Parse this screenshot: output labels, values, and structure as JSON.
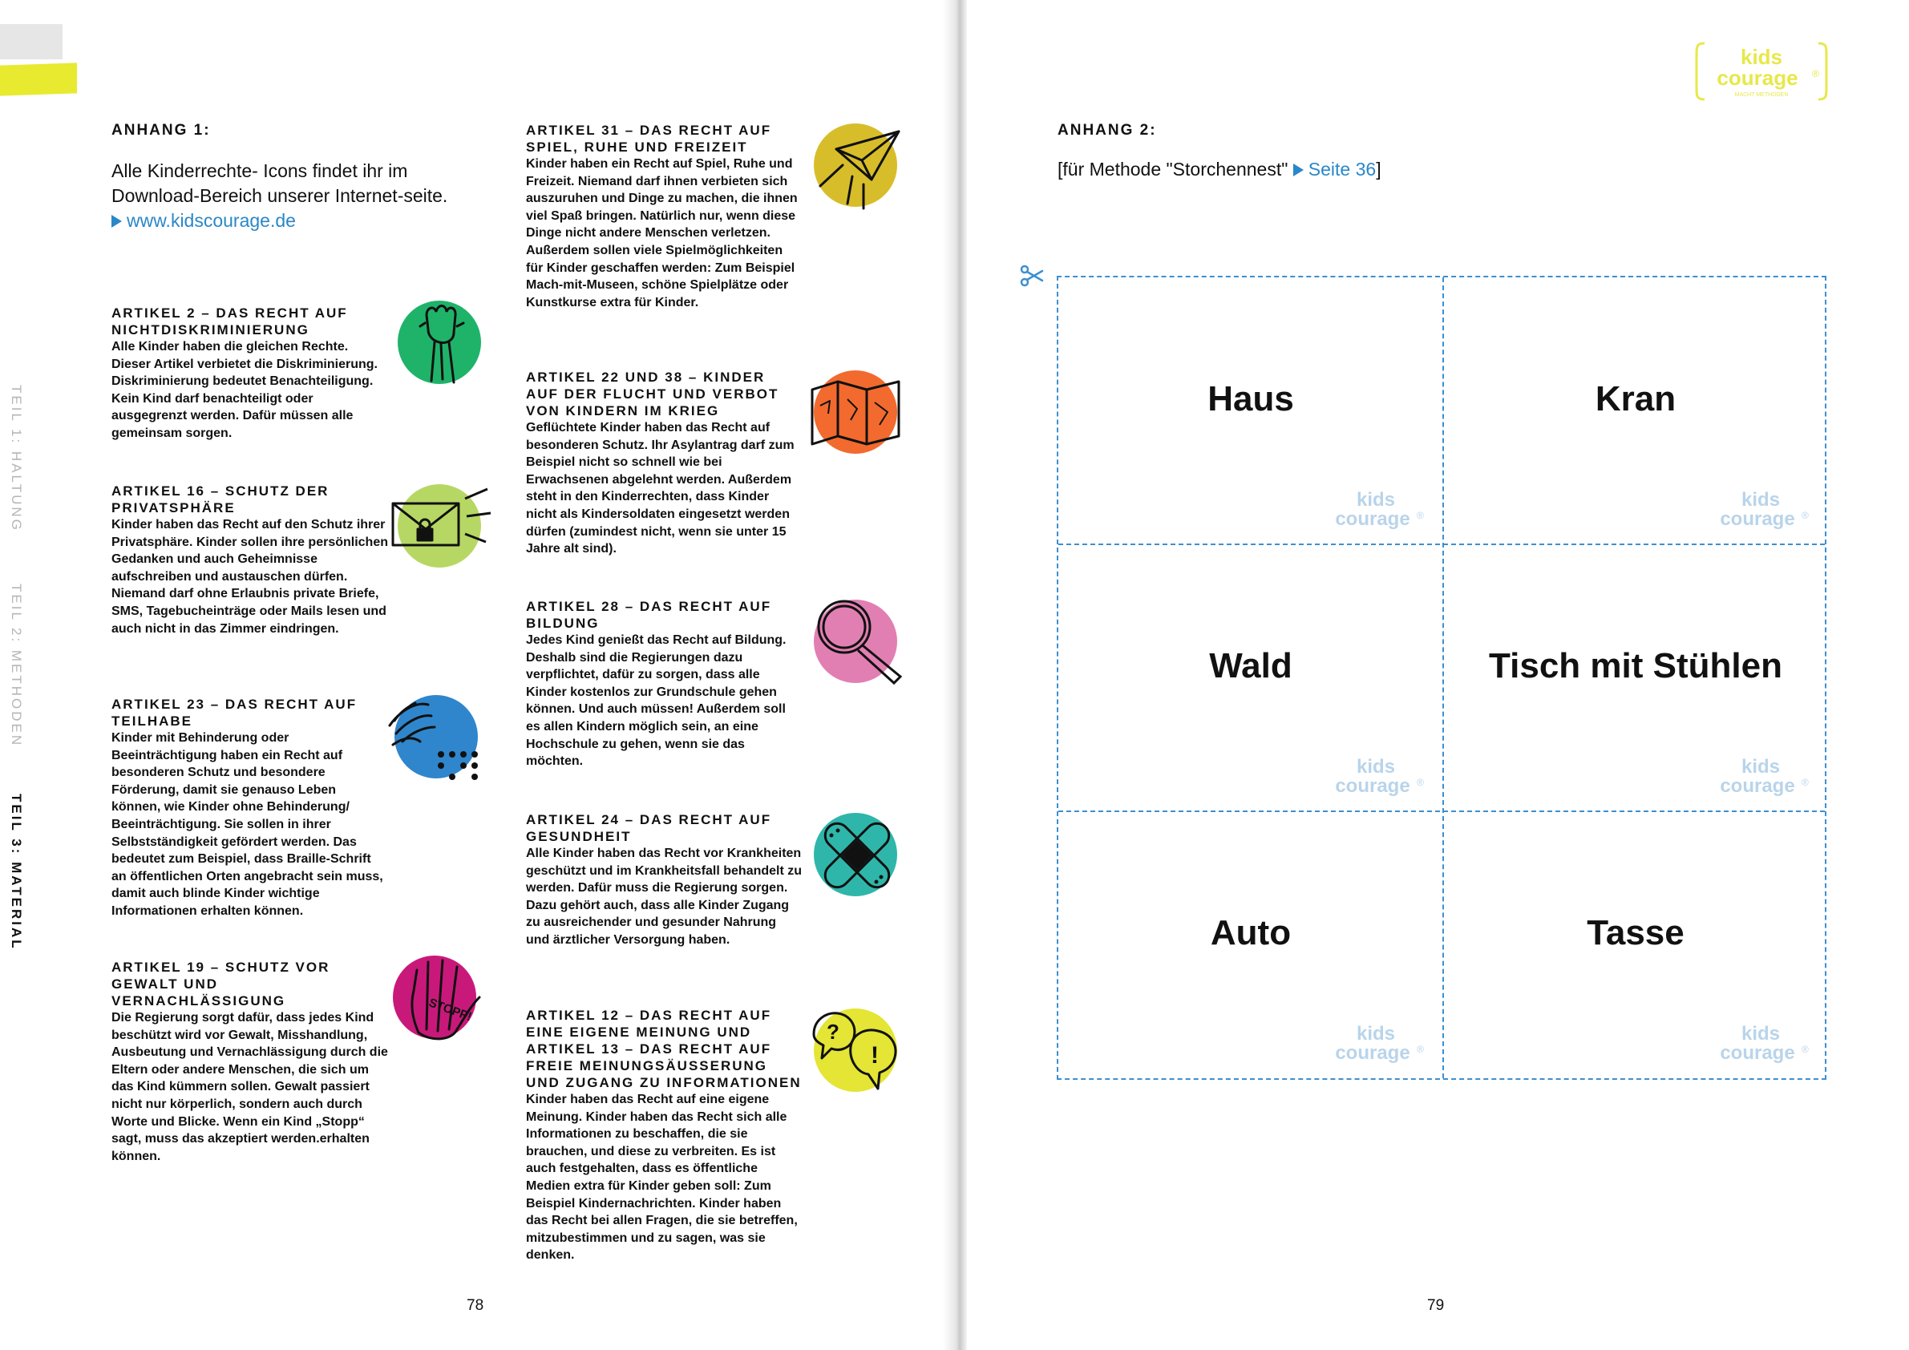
{
  "left_page": {
    "side_nav": [
      "TEIL 1: HALTUNG",
      "TEIL 2: METHODEN",
      "TEIL 3: MATERIAL"
    ],
    "heading": "ANHANG 1:",
    "intro_text": "Alle Kinderrechte- Icons findet ihr im Download-Bereich unserer Internet-seite.",
    "intro_link": "www.kidscourage.de",
    "page_number": "78",
    "col1": [
      {
        "title": "ARTIKEL 2 – DAS RECHT AUF NICHTDISKRIMINIERUNG",
        "text": "Alle Kinder haben die gleichen Rechte. Dieser Artikel verbietet die Diskriminierung. Diskriminierung bedeutet Benachteiligung. Kein Kind darf benachteiligt oder ausgegrenzt werden. Dafür müssen alle gemeinsam sorgen.",
        "icon": "raised-fist-icon",
        "color": "#1fb36a"
      },
      {
        "title": "ARTIKEL 16 – SCHUTZ DER PRIVATSPHÄRE",
        "text": "Kinder haben das Recht auf den Schutz ihrer Privatsphäre. Kinder sollen ihre persönlichen Gedanken und auch Geheimnisse aufschreiben und austauschen dürfen. Niemand darf ohne Erlaubnis private Briefe, SMS, Tagebucheinträge oder Mails lesen und auch nicht in das Zimmer eindringen.",
        "icon": "locked-envelope-icon",
        "color": "#b7d764"
      },
      {
        "title": "ARTIKEL 23 – DAS RECHT AUF TEILHABE",
        "text": "Kinder mit Behinderung oder Beeinträchtigung haben ein Recht auf besonderen Schutz und besondere Förderung, damit sie genauso Leben können, wie Kinder ohne Behinderung/ Beeinträchtigung. Sie sollen in ihrer Selbstständigkeit gefördert werden. Das bedeutet zum Beispiel, dass Braille-Schrift an öffentlichen Orten angebracht sein muss, damit auch blinde Kinder wichtige Informationen erhalten können.",
        "icon": "sign-language-braille-icon",
        "color": "#2f86cc"
      },
      {
        "title": "ARTIKEL 19 – SCHUTZ VOR GEWALT UND VERNACHLÄSSIGUNG",
        "text": "Die Regierung sorgt dafür, dass jedes Kind beschützt wird vor Gewalt, Misshandlung, Ausbeutung und Vernachlässigung durch die Eltern oder andere Menschen, die sich um das Kind kümmern sollen. Gewalt passiert nicht nur körperlich, sondern auch durch Worte und Blicke. Wenn ein Kind „Stopp“ sagt, muss das akzeptiert werden.erhalten können.",
        "icon": "stop-hand-icon",
        "color": "#c8197a",
        "badge": "STOPP!"
      }
    ],
    "col2": [
      {
        "title": "ARTIKEL 31 – DAS RECHT AUF SPIEL, RUHE UND FREIZEIT",
        "text": "Kinder haben ein Recht auf Spiel, Ruhe und Freizeit. Niemand darf ihnen verbieten sich auszuruhen und Dinge zu machen, die ihnen viel Spaß bringen. Natürlich nur, wenn diese Dinge nicht andere Menschen verletzen. Außerdem sollen viele Spielmöglichkeiten für Kinder geschaffen werden: Zum Beispiel Mach-mit-Museen, schöne Spielplätze oder Kunstkurse extra für Kinder.",
        "icon": "paper-plane-icon",
        "color": "#d8bd2b"
      },
      {
        "title": "ARTIKEL 22 UND 38 – KINDER AUF DER FLUCHT UND VERBOT VON KINDERN IM KRIEG",
        "text": "Geflüchtete Kinder haben das Recht auf besonderen Schutz. Ihr Asylantrag darf zum Beispiel nicht so schnell wie bei Erwachsenen abgelehnt werden. Außerdem steht in den Kinderrechten, dass Kinder nicht als Kindersoldaten eingesetzt werden dürfen (zumindest nicht, wenn sie unter 15 Jahre alt sind).",
        "icon": "folded-map-icon",
        "color": "#f26a2e"
      },
      {
        "title": "ARTIKEL 28 – DAS RECHT AUF BILDUNG",
        "text": "Jedes Kind genießt das Recht auf Bildung. Deshalb sind die Regierungen dazu verpflichtet, dafür zu sorgen, dass alle Kinder kostenlos zur Grundschule gehen können. Und auch müssen! Außerdem soll es allen Kindern möglich sein, an eine Hochschule zu gehen, wenn sie das möchten.",
        "icon": "magnifier-icon",
        "color": "#e17fb3"
      },
      {
        "title": "ARTIKEL 24 – DAS RECHT AUF GESUNDHEIT",
        "text": "Alle Kinder haben das Recht vor Krankheiten geschützt und im Krankheitsfall behandelt zu werden. Dafür muss die Regierung sorgen. Dazu gehört auch, dass alle Kinder Zugang zu ausreichender und gesunder Nahrung und ärztlicher Versorgung haben.",
        "icon": "bandage-icon",
        "color": "#2fb6aa"
      },
      {
        "title": "ARTIKEL 12 – DAS RECHT AUF EINE EIGENE MEINUNG und ARTIKEL 13 – DAS RECHT AUF FREIE MEINUNGSÄUSSERUNG UND ZUGANG ZU INFORMATIONEN",
        "text": "Kinder haben das Recht auf eine eigene Meinung. Kinder haben das Recht sich alle Informationen zu beschaffen, die sie brauchen, und diese zu verbreiten. Es ist auch festgehalten, dass es öffentliche Medien extra für Kinder geben soll: Zum Beispiel Kindernachrichten. Kinder haben das Recht bei allen Fragen, die sie betreffen, mitzubestimmen und zu sagen, was sie denken.",
        "icon": "speech-bubbles-icon",
        "color": "#e4e534"
      }
    ]
  },
  "right_page": {
    "heading": "ANHANG 2:",
    "method_prefix": "[für Methode \"Storchennest\"",
    "method_link": "Seite 36",
    "method_suffix": "]",
    "page_number": "79",
    "logo": {
      "line1": "kids",
      "line2": "courage",
      "reg": "®",
      "tagline": "MACHT METHODEN"
    },
    "watermark": {
      "line1": "kids",
      "line2": "courage",
      "reg": "®"
    },
    "cards": [
      "Haus",
      "Kran",
      "Wald",
      "Tisch mit Stühlen",
      "Auto",
      "Tasse"
    ],
    "colors": {
      "accent": "#3d8fd0",
      "link": "#2a87c8",
      "logo": "#e7e84a",
      "watermark": "#b9d4ea"
    }
  }
}
